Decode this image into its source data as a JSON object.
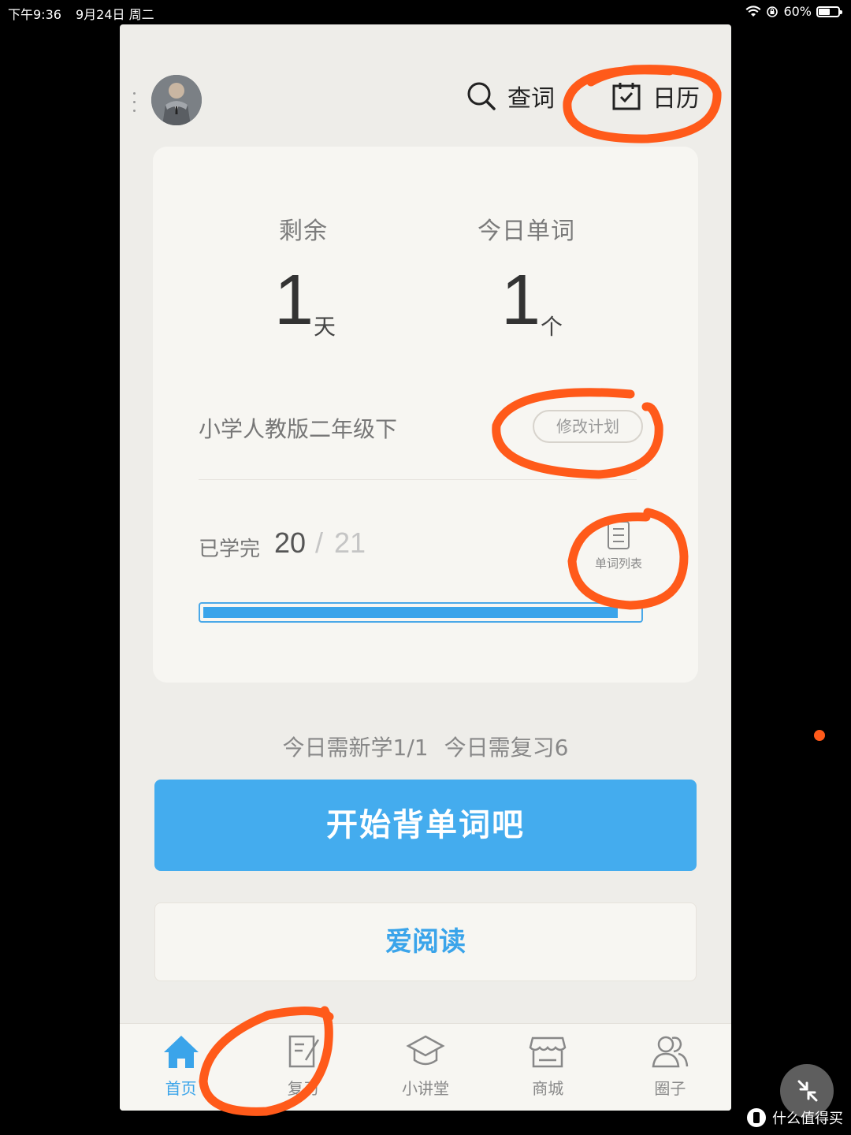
{
  "status_bar": {
    "time": "下午9:36",
    "date": "9月24日 周二",
    "battery_percent": "60%",
    "battery_level": 0.6
  },
  "header": {
    "lookup_label": "查词",
    "calendar_label": "日历"
  },
  "stats": {
    "remaining_label": "剩余",
    "remaining_value": "1",
    "remaining_unit": "天",
    "today_words_label": "今日单词",
    "today_words_value": "1",
    "today_words_unit": "个"
  },
  "plan": {
    "name": "小学人教版二年级下",
    "edit_label": "修改计划"
  },
  "progress": {
    "learned_label": "已学完",
    "learned_count": "20",
    "separator": "/",
    "total": "21",
    "fraction": 0.952,
    "word_list_label": "单词列表"
  },
  "today": {
    "new_text": "今日需新学1/1",
    "review_text": "今日需复习6"
  },
  "buttons": {
    "start_label": "开始背单词吧",
    "read_label": "爱阅读"
  },
  "tabs": [
    {
      "label": "首页",
      "icon": "home-icon",
      "active": true
    },
    {
      "label": "复习",
      "icon": "review-icon",
      "active": false
    },
    {
      "label": "小讲堂",
      "icon": "lecture-icon",
      "active": false
    },
    {
      "label": "商城",
      "icon": "store-icon",
      "active": false
    },
    {
      "label": "圈子",
      "icon": "community-icon",
      "active": false
    }
  ],
  "watermark": {
    "text": "什么值得买"
  },
  "colors": {
    "accent": "#44acee",
    "annotation": "#ff5a1a",
    "background": "#eeede9"
  }
}
